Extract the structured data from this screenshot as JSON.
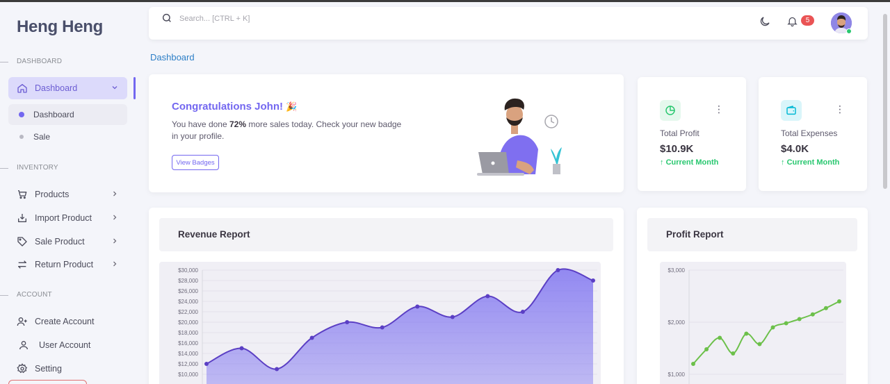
{
  "brand": "Heng Heng",
  "colors": {
    "accent": "#7367f0",
    "success": "#28c76f",
    "danger": "#ea5455",
    "link": "#2d7fc7"
  },
  "sidebar": {
    "sections": [
      {
        "title": "DASHBOARD"
      },
      {
        "title": "INVENTORY"
      },
      {
        "title": "ACCOUNT"
      }
    ],
    "dashboard": {
      "label": "Dashboard",
      "icon": "home-icon",
      "expanded": true
    },
    "dashboard_sub": [
      {
        "label": "Dashboard",
        "active": true
      },
      {
        "label": "Sale",
        "active": false
      }
    ],
    "inventory": [
      {
        "label": "Products",
        "icon": "cart-icon"
      },
      {
        "label": "Import Product",
        "icon": "import-icon"
      },
      {
        "label": "Sale Product",
        "icon": "tag-icon"
      },
      {
        "label": "Return Product",
        "icon": "swap-icon"
      }
    ],
    "account": [
      {
        "label": "Create Account",
        "icon": "user-plus-icon"
      },
      {
        "label": "User Account",
        "icon": "user-icon"
      },
      {
        "label": "Setting",
        "icon": "gear-icon"
      }
    ]
  },
  "topbar": {
    "search_placeholder": "Search... [CTRL + K]",
    "notification_count": "5"
  },
  "breadcrumb": "Dashboard",
  "congrats": {
    "title": "Congratulations John!",
    "emoji": "🎉",
    "text_before": "You have done ",
    "text_highlight": "72%",
    "text_after": " more sales today. Check your new badge in your profile.",
    "button": "View Badges"
  },
  "stats": [
    {
      "label": "Total Profit",
      "value": "$10.9K",
      "trend": "Current Month",
      "icon": "pie-chart-icon",
      "icon_color": "#28c76f",
      "icon_bg": "#e5f8ed"
    },
    {
      "label": "Total Expenses",
      "value": "$4.0K",
      "trend": "Current Month",
      "icon": "wallet-icon",
      "icon_color": "#00b8d4",
      "icon_bg": "#d9f5fa"
    }
  ],
  "revenue_report": {
    "title": "Revenue Report"
  },
  "profit_report": {
    "title": "Profit Report"
  },
  "chart_data": [
    {
      "type": "area",
      "title": "Revenue Report",
      "y_ticks": [
        "$30,000",
        "$28,000",
        "$26,000",
        "$24,000",
        "$22,000",
        "$20,000",
        "$18,000",
        "$16,000",
        "$14,000",
        "$12,000",
        "$10,000"
      ],
      "ylim": [
        10000,
        30000
      ],
      "values": [
        12000,
        15000,
        11000,
        17000,
        20000,
        19000,
        23000,
        21000,
        25000,
        22000,
        30000,
        28000
      ],
      "color": "#7367f0"
    },
    {
      "type": "line",
      "title": "Profit Report",
      "y_ticks": [
        "$3,000",
        "$2,000",
        "$1,000"
      ],
      "ylim": [
        1000,
        3000
      ],
      "values": [
        1200,
        1480,
        1700,
        1400,
        1780,
        1580,
        1900,
        1980,
        2060,
        2150,
        2270,
        2400
      ],
      "color": "#7cc65d"
    }
  ]
}
